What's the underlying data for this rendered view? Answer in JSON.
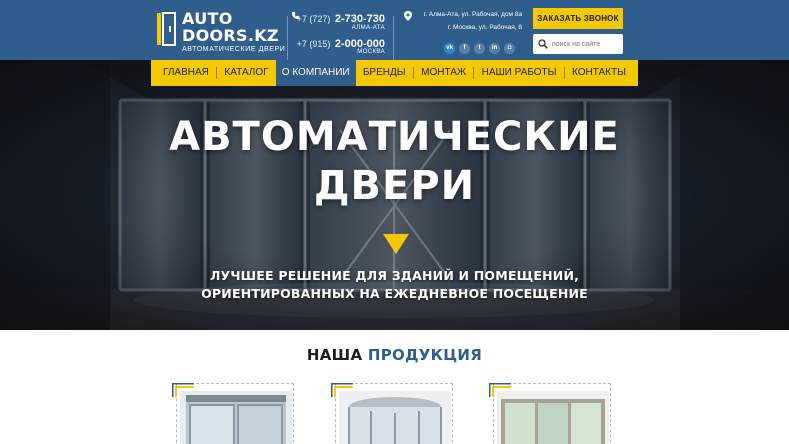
{
  "header": {
    "logo": {
      "line1": "AUTO",
      "line2": "DOORS.KZ",
      "tagline": "АВТОМАТИЧЕСКИЕ ДВЕРИ"
    },
    "phones": [
      {
        "prefix": "+7 (727)",
        "number": "2-730-730",
        "city": "АЛМА-АТА"
      },
      {
        "prefix": "+7 (915)",
        "number": "2-000-000",
        "city": "МОСКВА"
      }
    ],
    "addresses": [
      "г. Алма-Ата, ул. Рабочая, дом 8а",
      "г. Москва, ул. Рабочая, 8"
    ],
    "socials": [
      {
        "icon": "vk-icon",
        "glyph": "vk"
      },
      {
        "icon": "facebook-icon",
        "glyph": "f"
      },
      {
        "icon": "twitter-icon",
        "glyph": "t"
      },
      {
        "icon": "linkedin-icon",
        "glyph": "in"
      },
      {
        "icon": "instagram-icon",
        "glyph": "◘"
      }
    ],
    "callback_label": "ЗАКАЗАТЬ ЗВОНОК",
    "search": {
      "placeholder": "поиск на сайте",
      "value": ""
    }
  },
  "nav": {
    "items": [
      "ГЛАВНАЯ",
      "КАТАЛОГ",
      "О КОМПАНИИ",
      "БРЕНДЫ",
      "МОНТАЖ",
      "НАШИ РАБОТЫ",
      "КОНТАКТЫ"
    ],
    "active": "О КОМПАНИИ"
  },
  "hero": {
    "title_line1": "АВТОМАТИЧЕСКИЕ",
    "title_line2": "ДВЕРИ",
    "subtitle_line1": "ЛУЧШЕЕ РЕШЕНИЕ ДЛЯ ЗДАНИЙ И ПОМЕЩЕНИЙ,",
    "subtitle_line2": "ОРИЕНТИРОВАННЫХ НА ЕЖЕДНЕВНОЕ ПОСЕЩЕНИЕ"
  },
  "products": {
    "title_dark": "НАША",
    "title_accent": "ПРОДУКЦИЯ"
  },
  "colors": {
    "header_bg": "#2f5d8c",
    "accent_yellow": "#f5c900",
    "accent_blue": "#2f5d8c"
  }
}
